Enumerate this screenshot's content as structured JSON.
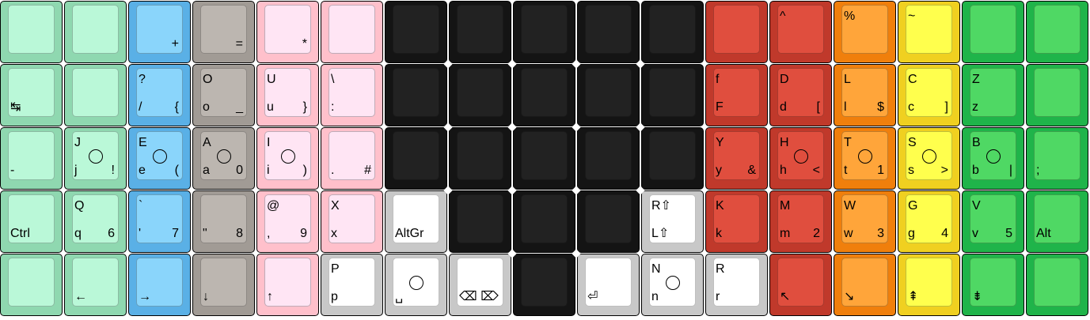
{
  "palette": {
    "mint": {
      "base": "#8fd8b0",
      "cap": "#baf8d8"
    },
    "blue": {
      "base": "#5ab0e6",
      "cap": "#8ad5fb"
    },
    "grey": {
      "base": "#a19b95",
      "cap": "#bcb6b0"
    },
    "pink": {
      "base": "#ffc0cb",
      "cap": "#ffe5f4"
    },
    "white": {
      "base": "#c8c8c8",
      "cap": "#ffffff"
    },
    "black": {
      "base": "#141414",
      "cap": "#222222"
    },
    "red": {
      "base": "#c0392b",
      "cap": "#e04e3e"
    },
    "orange": {
      "base": "#f07f0c",
      "cap": "#ffa53a"
    },
    "yellow": {
      "base": "#f0d020",
      "cap": "#ffff4d"
    },
    "green": {
      "base": "#1fb44a",
      "cap": "#4fd864"
    }
  },
  "rows": [
    [
      {
        "color": "mint"
      },
      {
        "color": "mint"
      },
      {
        "color": "blue",
        "br": "+"
      },
      {
        "color": "grey",
        "br": "="
      },
      {
        "color": "pink",
        "br": "*"
      },
      {
        "color": "pink"
      },
      {
        "color": "black"
      },
      {
        "color": "black"
      },
      {
        "color": "black"
      },
      {
        "color": "black"
      },
      {
        "color": "black"
      },
      {
        "color": "red"
      },
      {
        "color": "red",
        "tl": "^"
      },
      {
        "color": "orange",
        "tl": "%"
      },
      {
        "color": "yellow",
        "tl": "~"
      },
      {
        "color": "green"
      },
      {
        "color": "green"
      }
    ],
    [
      {
        "color": "mint",
        "bl": "↹"
      },
      {
        "color": "mint"
      },
      {
        "color": "blue",
        "tl": "?",
        "bl": "/",
        "br": "{"
      },
      {
        "color": "grey",
        "tl": "O",
        "bl": "o",
        "br": "_"
      },
      {
        "color": "pink",
        "tl": "U",
        "bl": "u",
        "br": "}"
      },
      {
        "color": "pink",
        "tl": "\\",
        "bl": ":"
      },
      {
        "color": "black"
      },
      {
        "color": "black"
      },
      {
        "color": "black"
      },
      {
        "color": "black"
      },
      {
        "color": "black"
      },
      {
        "color": "red",
        "tl": "f",
        "bl": "F"
      },
      {
        "color": "red",
        "tl": "D",
        "bl": "d",
        "br": "["
      },
      {
        "color": "orange",
        "tl": "L",
        "bl": "l",
        "br": "$"
      },
      {
        "color": "yellow",
        "tl": "C",
        "bl": "c",
        "br": "]"
      },
      {
        "color": "green",
        "tl": "Z",
        "bl": "z"
      },
      {
        "color": "green"
      }
    ],
    [
      {
        "color": "mint",
        "bl": "-"
      },
      {
        "color": "mint",
        "tl": "J",
        "bl": "j",
        "br": "!",
        "homing": true
      },
      {
        "color": "blue",
        "tl": "E",
        "bl": "e",
        "br": "(",
        "homing": true
      },
      {
        "color": "grey",
        "tl": "A",
        "bl": "a",
        "br": "0",
        "homing": true
      },
      {
        "color": "pink",
        "tl": "I",
        "bl": "i",
        "br": ")",
        "homing": true
      },
      {
        "color": "pink",
        "bl": ".",
        "br": "#"
      },
      {
        "color": "black"
      },
      {
        "color": "black"
      },
      {
        "color": "black"
      },
      {
        "color": "black"
      },
      {
        "color": "black"
      },
      {
        "color": "red",
        "tl": "Y",
        "bl": "y",
        "br": "&"
      },
      {
        "color": "red",
        "tl": "H",
        "bl": "h",
        "br": "<",
        "homing": true
      },
      {
        "color": "orange",
        "tl": "T",
        "bl": "t",
        "br": "1",
        "homing": true
      },
      {
        "color": "yellow",
        "tl": "S",
        "bl": "s",
        "br": ">",
        "homing": true
      },
      {
        "color": "green",
        "tl": "B",
        "bl": "b",
        "br": "|",
        "homing": true
      },
      {
        "color": "green",
        "bl": ";"
      }
    ],
    [
      {
        "color": "mint",
        "bl": "Ctrl"
      },
      {
        "color": "mint",
        "tl": "Q",
        "bl": "q",
        "br": "6"
      },
      {
        "color": "blue",
        "tl": "`",
        "bl": "'",
        "br": "7"
      },
      {
        "color": "grey",
        "bl": "\"",
        "br": "8"
      },
      {
        "color": "pink",
        "tl": "@",
        "bl": ",",
        "br": "9"
      },
      {
        "color": "pink",
        "tl": "X",
        "bl": "x"
      },
      {
        "color": "white",
        "bl": "AltGr"
      },
      {
        "color": "black"
      },
      {
        "color": "black"
      },
      {
        "color": "black"
      },
      {
        "color": "white",
        "tl": "R⇧",
        "bl": "L⇧"
      },
      {
        "color": "red",
        "tl": "K",
        "bl": "k"
      },
      {
        "color": "red",
        "tl": "M",
        "bl": "m",
        "br": "2"
      },
      {
        "color": "orange",
        "tl": "W",
        "bl": "w",
        "br": "3"
      },
      {
        "color": "yellow",
        "tl": "G",
        "bl": "g",
        "br": "4"
      },
      {
        "color": "green",
        "tl": "V",
        "bl": "v",
        "br": "5"
      },
      {
        "color": "green",
        "bl": "Alt"
      }
    ],
    [
      {
        "color": "mint"
      },
      {
        "color": "mint",
        "bl": "←"
      },
      {
        "color": "blue",
        "bl": "→"
      },
      {
        "color": "grey",
        "bl": "↓"
      },
      {
        "color": "pink",
        "bl": "↑"
      },
      {
        "color": "white",
        "tl": "P",
        "bl": "p"
      },
      {
        "color": "white",
        "bl": "␣",
        "homing": true
      },
      {
        "color": "white",
        "bl": "⌫ ⌦"
      },
      {
        "color": "black"
      },
      {
        "color": "white",
        "bl": "⏎"
      },
      {
        "color": "white",
        "tl": "N",
        "bl": "n",
        "homing": true
      },
      {
        "color": "white",
        "tl": "R",
        "bl": "r"
      },
      {
        "color": "red",
        "bl": "↖"
      },
      {
        "color": "orange",
        "bl": "↘"
      },
      {
        "color": "yellow",
        "bl": "⇞"
      },
      {
        "color": "green",
        "bl": "⇟"
      },
      {
        "color": "green"
      }
    ]
  ]
}
